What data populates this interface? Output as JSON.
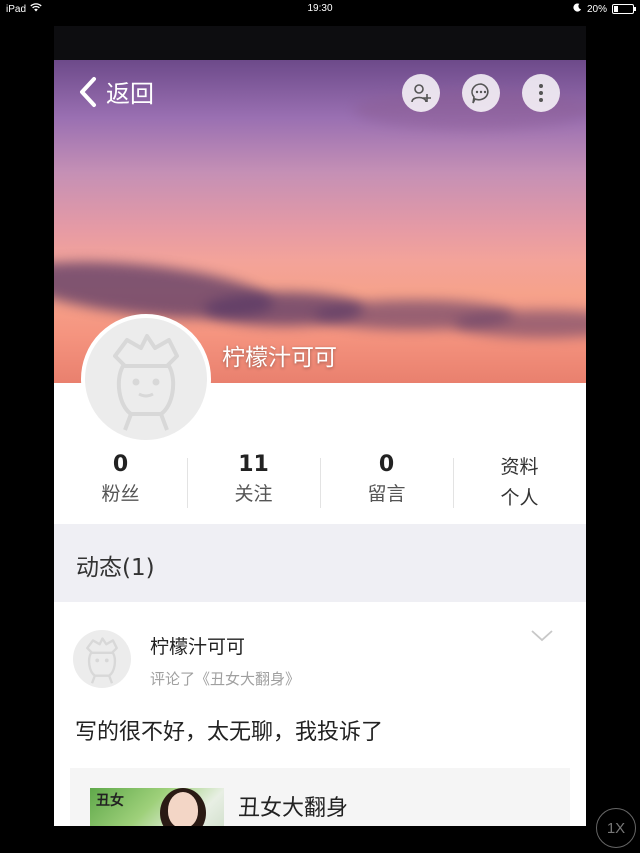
{
  "status_bar": {
    "device": "iPad",
    "time": "19:30",
    "battery": "20%",
    "battery_level": 0.2
  },
  "nav": {
    "back_label": "返回"
  },
  "profile": {
    "name": "柠檬汁可可"
  },
  "stats": [
    {
      "value": "0",
      "label": "粉丝"
    },
    {
      "value": "11",
      "label": "关注"
    },
    {
      "value": "0",
      "label": "留言"
    }
  ],
  "profile_info": {
    "line1": "资料",
    "line2": "个人"
  },
  "feed": {
    "title": "动态(1)",
    "post": {
      "author": "柠檬汁可可",
      "action": "评论了《丑女大翻身》",
      "content": "写的很不好，太无聊，我投诉了",
      "book": {
        "title": "丑女大翻身",
        "cover_text": "丑女"
      }
    }
  },
  "zoom": {
    "label": "1X"
  },
  "colors": {
    "accent_bg": "#efeff4",
    "muted_text": "#a0a0a0"
  }
}
